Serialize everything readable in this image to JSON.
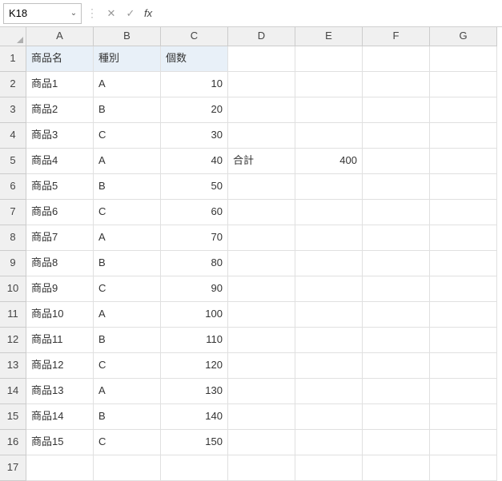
{
  "nameBox": {
    "value": "K18"
  },
  "formulaBar": {
    "value": ""
  },
  "columns": [
    "A",
    "B",
    "C",
    "D",
    "E",
    "F",
    "G"
  ],
  "headers": {
    "A": "商品名",
    "B": "種別",
    "C": "個数"
  },
  "rows": [
    {
      "n": "1",
      "A": "商品名",
      "B": "種別",
      "C": "個数",
      "D": "",
      "E": "",
      "header": true
    },
    {
      "n": "2",
      "A": "商品1",
      "B": "A",
      "C": "10",
      "D": "",
      "E": ""
    },
    {
      "n": "3",
      "A": "商品2",
      "B": "B",
      "C": "20",
      "D": "",
      "E": ""
    },
    {
      "n": "4",
      "A": "商品3",
      "B": "C",
      "C": "30",
      "D": "",
      "E": ""
    },
    {
      "n": "5",
      "A": "商品4",
      "B": "A",
      "C": "40",
      "D": "合計",
      "E": "400"
    },
    {
      "n": "6",
      "A": "商品5",
      "B": "B",
      "C": "50",
      "D": "",
      "E": ""
    },
    {
      "n": "7",
      "A": "商品6",
      "B": "C",
      "C": "60",
      "D": "",
      "E": ""
    },
    {
      "n": "8",
      "A": "商品7",
      "B": "A",
      "C": "70",
      "D": "",
      "E": ""
    },
    {
      "n": "9",
      "A": "商品8",
      "B": "B",
      "C": "80",
      "D": "",
      "E": ""
    },
    {
      "n": "10",
      "A": "商品9",
      "B": "C",
      "C": "90",
      "D": "",
      "E": ""
    },
    {
      "n": "11",
      "A": "商品10",
      "B": "A",
      "C": "100",
      "D": "",
      "E": ""
    },
    {
      "n": "12",
      "A": "商品11",
      "B": "B",
      "C": "110",
      "D": "",
      "E": ""
    },
    {
      "n": "13",
      "A": "商品12",
      "B": "C",
      "C": "120",
      "D": "",
      "E": ""
    },
    {
      "n": "14",
      "A": "商品13",
      "B": "A",
      "C": "130",
      "D": "",
      "E": ""
    },
    {
      "n": "15",
      "A": "商品14",
      "B": "B",
      "C": "140",
      "D": "",
      "E": ""
    },
    {
      "n": "16",
      "A": "商品15",
      "B": "C",
      "C": "150",
      "D": "",
      "E": ""
    },
    {
      "n": "17",
      "A": "",
      "B": "",
      "C": "",
      "D": "",
      "E": ""
    }
  ],
  "icons": {
    "chevronDown": "⌄",
    "dots": "⋮",
    "cancel": "✕",
    "confirm": "✓",
    "fx": "fx"
  }
}
